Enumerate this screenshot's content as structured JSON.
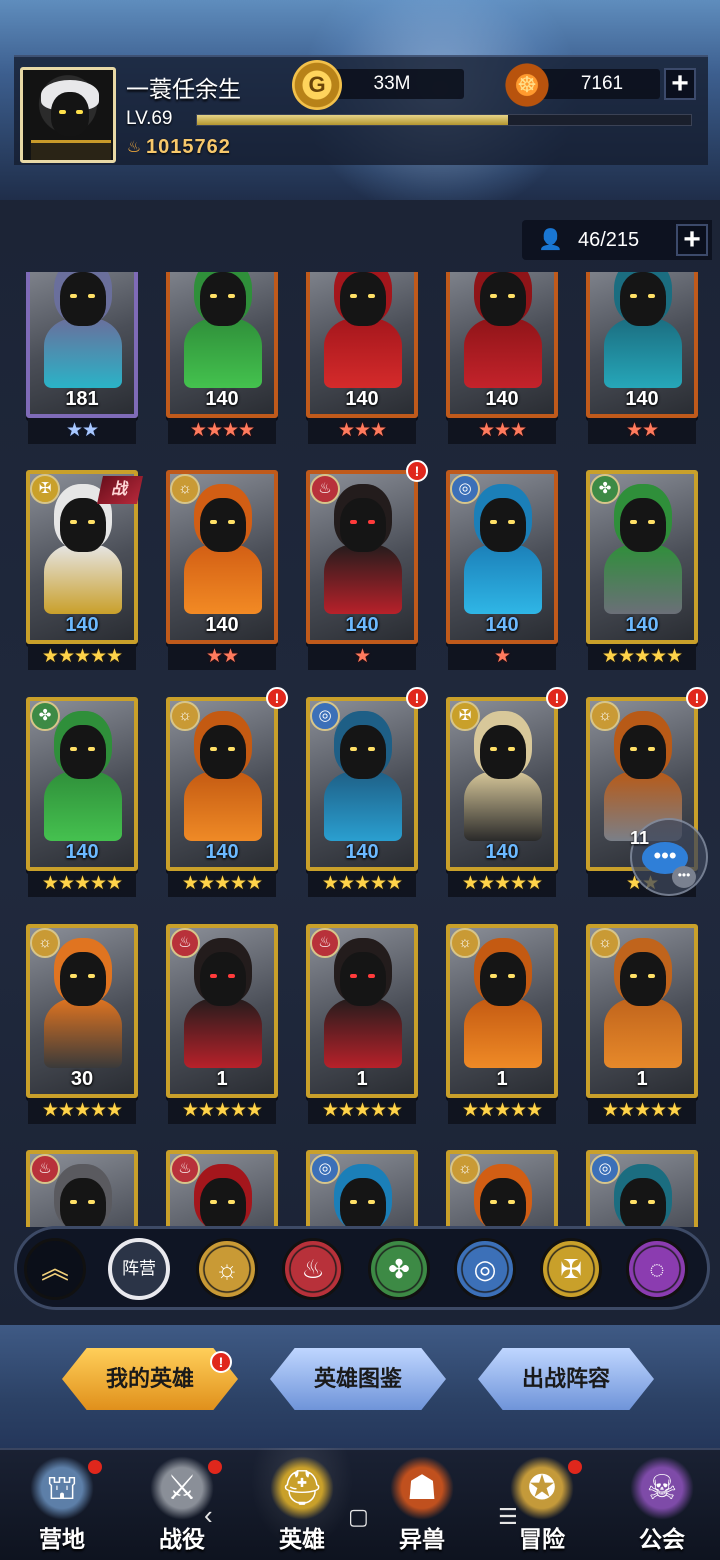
{
  "player": {
    "name": "一蓑任余生",
    "level_label": "LV.69",
    "xp_fraction": 0.63,
    "power": "1015762",
    "power_icon": "flame-icon"
  },
  "resources": {
    "gold_icon_glyph": "G",
    "gold": "33M",
    "gem": "7161",
    "plus": "+"
  },
  "roster": {
    "count": "46/215",
    "plus": "+"
  },
  "battle_tag": "战",
  "alert_glyph": "!",
  "faction_glyphs": {
    "light": "☼",
    "fire": "♨",
    "nature": "✤",
    "water": "◎",
    "holy": "✠",
    "void": "◌"
  },
  "cards": [
    {
      "level": "181",
      "stars": "★★",
      "star_color": "blue",
      "level_color": "white",
      "frame": "purple",
      "faction": "",
      "palette": [
        "#6a6f9c",
        "#2ab3c7"
      ],
      "alert": false
    },
    {
      "level": "140",
      "stars": "★★★★",
      "star_color": "red",
      "level_color": "white",
      "frame": "orange",
      "faction": "",
      "palette": [
        "#2f8f3a",
        "#44c24e"
      ],
      "alert": false
    },
    {
      "level": "140",
      "stars": "★★★",
      "star_color": "red",
      "level_color": "white",
      "frame": "orange",
      "faction": "",
      "palette": [
        "#a4161c",
        "#d52b2b"
      ],
      "alert": false
    },
    {
      "level": "140",
      "stars": "★★★",
      "star_color": "red",
      "level_color": "white",
      "frame": "orange",
      "faction": "",
      "palette": [
        "#8f1418",
        "#c4232b"
      ],
      "alert": false
    },
    {
      "level": "140",
      "stars": "★★",
      "star_color": "red",
      "level_color": "white",
      "frame": "orange",
      "faction": "",
      "palette": [
        "#1b6d80",
        "#26a7b9"
      ],
      "alert": false
    },
    {
      "level": "140",
      "stars": "★★★★★",
      "star_color": "gold",
      "level_color": "blue",
      "frame": "gold",
      "faction": "holy",
      "palette": [
        "#e6e6e6",
        "#c9a02a"
      ],
      "alert": false,
      "tag": true
    },
    {
      "level": "140",
      "stars": "★★",
      "star_color": "red",
      "level_color": "white",
      "frame": "orange",
      "faction": "light",
      "palette": [
        "#d25e14",
        "#f28a24"
      ],
      "alert": false
    },
    {
      "level": "140",
      "stars": "★",
      "star_color": "red",
      "level_color": "blue",
      "frame": "orange",
      "faction": "fire",
      "palette": [
        "#231c1c",
        "#b8212a"
      ],
      "alert": true
    },
    {
      "level": "140",
      "stars": "★",
      "star_color": "red",
      "level_color": "blue",
      "frame": "orange",
      "faction": "water",
      "palette": [
        "#1b7fb8",
        "#2fb6e6"
      ],
      "alert": false
    },
    {
      "level": "140",
      "stars": "★★★★★",
      "star_color": "gold",
      "level_color": "blue",
      "frame": "gold",
      "faction": "nature",
      "palette": [
        "#2f8f3a",
        "#6b6f78"
      ],
      "alert": false
    },
    {
      "level": "140",
      "stars": "★★★★★",
      "star_color": "gold",
      "level_color": "blue",
      "frame": "gold",
      "faction": "nature",
      "palette": [
        "#2f8f3a",
        "#45c14f"
      ],
      "alert": false
    },
    {
      "level": "140",
      "stars": "★★★★★",
      "star_color": "gold",
      "level_color": "blue",
      "frame": "gold",
      "faction": "light",
      "palette": [
        "#c45a12",
        "#ef8a26"
      ],
      "alert": true
    },
    {
      "level": "140",
      "stars": "★★★★★",
      "star_color": "gold",
      "level_color": "blue",
      "frame": "gold",
      "faction": "water",
      "palette": [
        "#1e5f86",
        "#2a9fd0"
      ],
      "alert": true
    },
    {
      "level": "140",
      "stars": "★★★★★",
      "star_color": "gold",
      "level_color": "blue",
      "frame": "gold",
      "faction": "holy",
      "palette": [
        "#d8c89a",
        "#2a2a2a"
      ],
      "alert": true
    },
    {
      "level": "",
      "stars": "★★",
      "star_color": "gold",
      "level_color": "white",
      "frame": "gold",
      "faction": "light",
      "palette": [
        "#b85a17",
        "#7a7f88"
      ],
      "alert": true
    },
    {
      "level": "30",
      "stars": "★★★★★",
      "star_color": "gold",
      "level_color": "white",
      "frame": "gold",
      "faction": "light",
      "palette": [
        "#e07420",
        "#3a3a3a"
      ],
      "alert": false
    },
    {
      "level": "1",
      "stars": "★★★★★",
      "star_color": "gold",
      "level_color": "white",
      "frame": "gold",
      "faction": "fire",
      "palette": [
        "#231c1c",
        "#b8212a"
      ],
      "alert": false
    },
    {
      "level": "1",
      "stars": "★★★★★",
      "star_color": "gold",
      "level_color": "white",
      "frame": "gold",
      "faction": "fire",
      "palette": [
        "#231c1c",
        "#b8212a"
      ],
      "alert": false
    },
    {
      "level": "1",
      "stars": "★★★★★",
      "star_color": "gold",
      "level_color": "white",
      "frame": "gold",
      "faction": "light",
      "palette": [
        "#c45a12",
        "#ef8a26"
      ],
      "alert": false
    },
    {
      "level": "1",
      "stars": "★★★★★",
      "star_color": "gold",
      "level_color": "white",
      "frame": "gold",
      "faction": "light",
      "palette": [
        "#c0641c",
        "#e7892a"
      ],
      "alert": false
    },
    {
      "level": "",
      "stars": "",
      "star_color": "gold",
      "level_color": "white",
      "frame": "gold",
      "faction": "fire",
      "palette": [
        "#5a5a5f",
        "#a4161c"
      ],
      "alert": false
    },
    {
      "level": "",
      "stars": "",
      "star_color": "gold",
      "level_color": "white",
      "frame": "gold",
      "faction": "fire",
      "palette": [
        "#a4161c",
        "#d52b2b"
      ],
      "alert": false
    },
    {
      "level": "",
      "stars": "",
      "star_color": "gold",
      "level_color": "white",
      "frame": "gold",
      "faction": "water",
      "palette": [
        "#1b7fb8",
        "#2fb6e6"
      ],
      "alert": false
    },
    {
      "level": "",
      "stars": "",
      "star_color": "gold",
      "level_color": "white",
      "frame": "gold",
      "faction": "light",
      "palette": [
        "#d25e14",
        "#f28a24"
      ],
      "alert": false
    },
    {
      "level": "",
      "stars": "",
      "star_color": "gold",
      "level_color": "white",
      "frame": "gold",
      "faction": "water",
      "palette": [
        "#1b6d80",
        "#26a7b9"
      ],
      "alert": false
    }
  ],
  "chat": {
    "count": "11",
    "dots": "•••"
  },
  "filter": {
    "collapse_glyph": "︽",
    "camp_label": "阵营",
    "factions": [
      {
        "name": "light",
        "glyph": "☼",
        "color": "#c99a35"
      },
      {
        "name": "fire",
        "glyph": "♨",
        "color": "#b8313a"
      },
      {
        "name": "nature",
        "glyph": "✤",
        "color": "#3d8a45"
      },
      {
        "name": "water",
        "glyph": "◎",
        "color": "#3c70b8"
      },
      {
        "name": "holy",
        "glyph": "✠",
        "color": "#c9a02a"
      },
      {
        "name": "void",
        "glyph": "◌",
        "color": "#8b3cb0"
      }
    ]
  },
  "actions": {
    "my_heroes": "我的英雄",
    "hero_dex": "英雄图鉴",
    "lineup": "出战阵容"
  },
  "nav": [
    {
      "label": "营地",
      "icon": "camp-icon",
      "glyph": "⛫",
      "color": "#5d7fa8",
      "dot": true
    },
    {
      "label": "战役",
      "icon": "crossed-swords-icon",
      "glyph": "⚔",
      "color": "#8a8f98",
      "dot": true
    },
    {
      "label": "英雄",
      "icon": "knight-helmet-icon",
      "glyph": "⛑",
      "color": "#c9a02a",
      "dot": false,
      "active": true
    },
    {
      "label": "异兽",
      "icon": "beast-icon",
      "glyph": "☗",
      "color": "#c0501e",
      "dot": false
    },
    {
      "label": "冒险",
      "icon": "compass-icon",
      "glyph": "✪",
      "color": "#c49a3a",
      "dot": true
    },
    {
      "label": "公会",
      "icon": "guild-scroll-icon",
      "glyph": "☠",
      "color": "#7e4ba8",
      "dot": false
    }
  ],
  "system_nav": {
    "back": "‹",
    "home": "▢",
    "recents": "☰"
  }
}
